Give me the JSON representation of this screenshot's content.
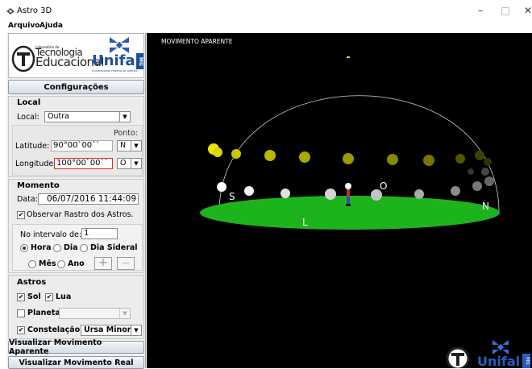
{
  "window": {
    "title": "Astro 3D",
    "minimize": "–",
    "maximize": "□",
    "close": "✕"
  },
  "menu": {
    "file": "Arquivo",
    "help": "Ajuda"
  },
  "logo": {
    "small": "Laboratório de",
    "line1": "Tecnologia",
    "line2": "Educacional",
    "brand": "Unifal",
    "mg": "MG",
    "sub": "Universidade Federal de Alfenas"
  },
  "config_label": "Configurações",
  "local": {
    "heading": "Local",
    "local_label": "Local:",
    "local_value": "Outra",
    "ponto_label": "Ponto:",
    "lat_label": "Latitude:",
    "lat_value": "90°00`00``",
    "lat_dir": "N",
    "lon_label": "Longitude:",
    "lon_value": "100°00`00``",
    "lon_dir": "O"
  },
  "momento": {
    "heading": "Momento",
    "data_label": "Data:",
    "data_value": "06/07/2016 11:44:09",
    "trail_label": "Observar Rastro dos Astros.",
    "interval_label": "No intervalo de:",
    "interval_value": "1",
    "units": {
      "hora": "Hora",
      "dia": "Dia",
      "dia_sideral": "Dia Sideral",
      "mes": "Mês",
      "ano": "Ano"
    },
    "selected_unit": "hora",
    "plus": "+",
    "minus": "—"
  },
  "astros": {
    "heading": "Astros",
    "sol": "Sol",
    "lua": "Lua",
    "planeta": "Planeta:",
    "planeta_value": "",
    "constelacao": "Constelação:",
    "constelacao_value": "Ursa Minor"
  },
  "buttons": {
    "aparente": "Visualizar Movimento Aparente",
    "real": "Visualizar Movimento Real"
  },
  "view": {
    "title": "MOVIMENTO APARENTE",
    "south": "S",
    "north": "N",
    "east": "L",
    "west": "O",
    "brand": "Unifal",
    "mg": "MG",
    "colors": {
      "sky": "#000000",
      "ground": "#1db31d",
      "sun": "#d9d900",
      "moon": "#e8e8e8"
    }
  }
}
